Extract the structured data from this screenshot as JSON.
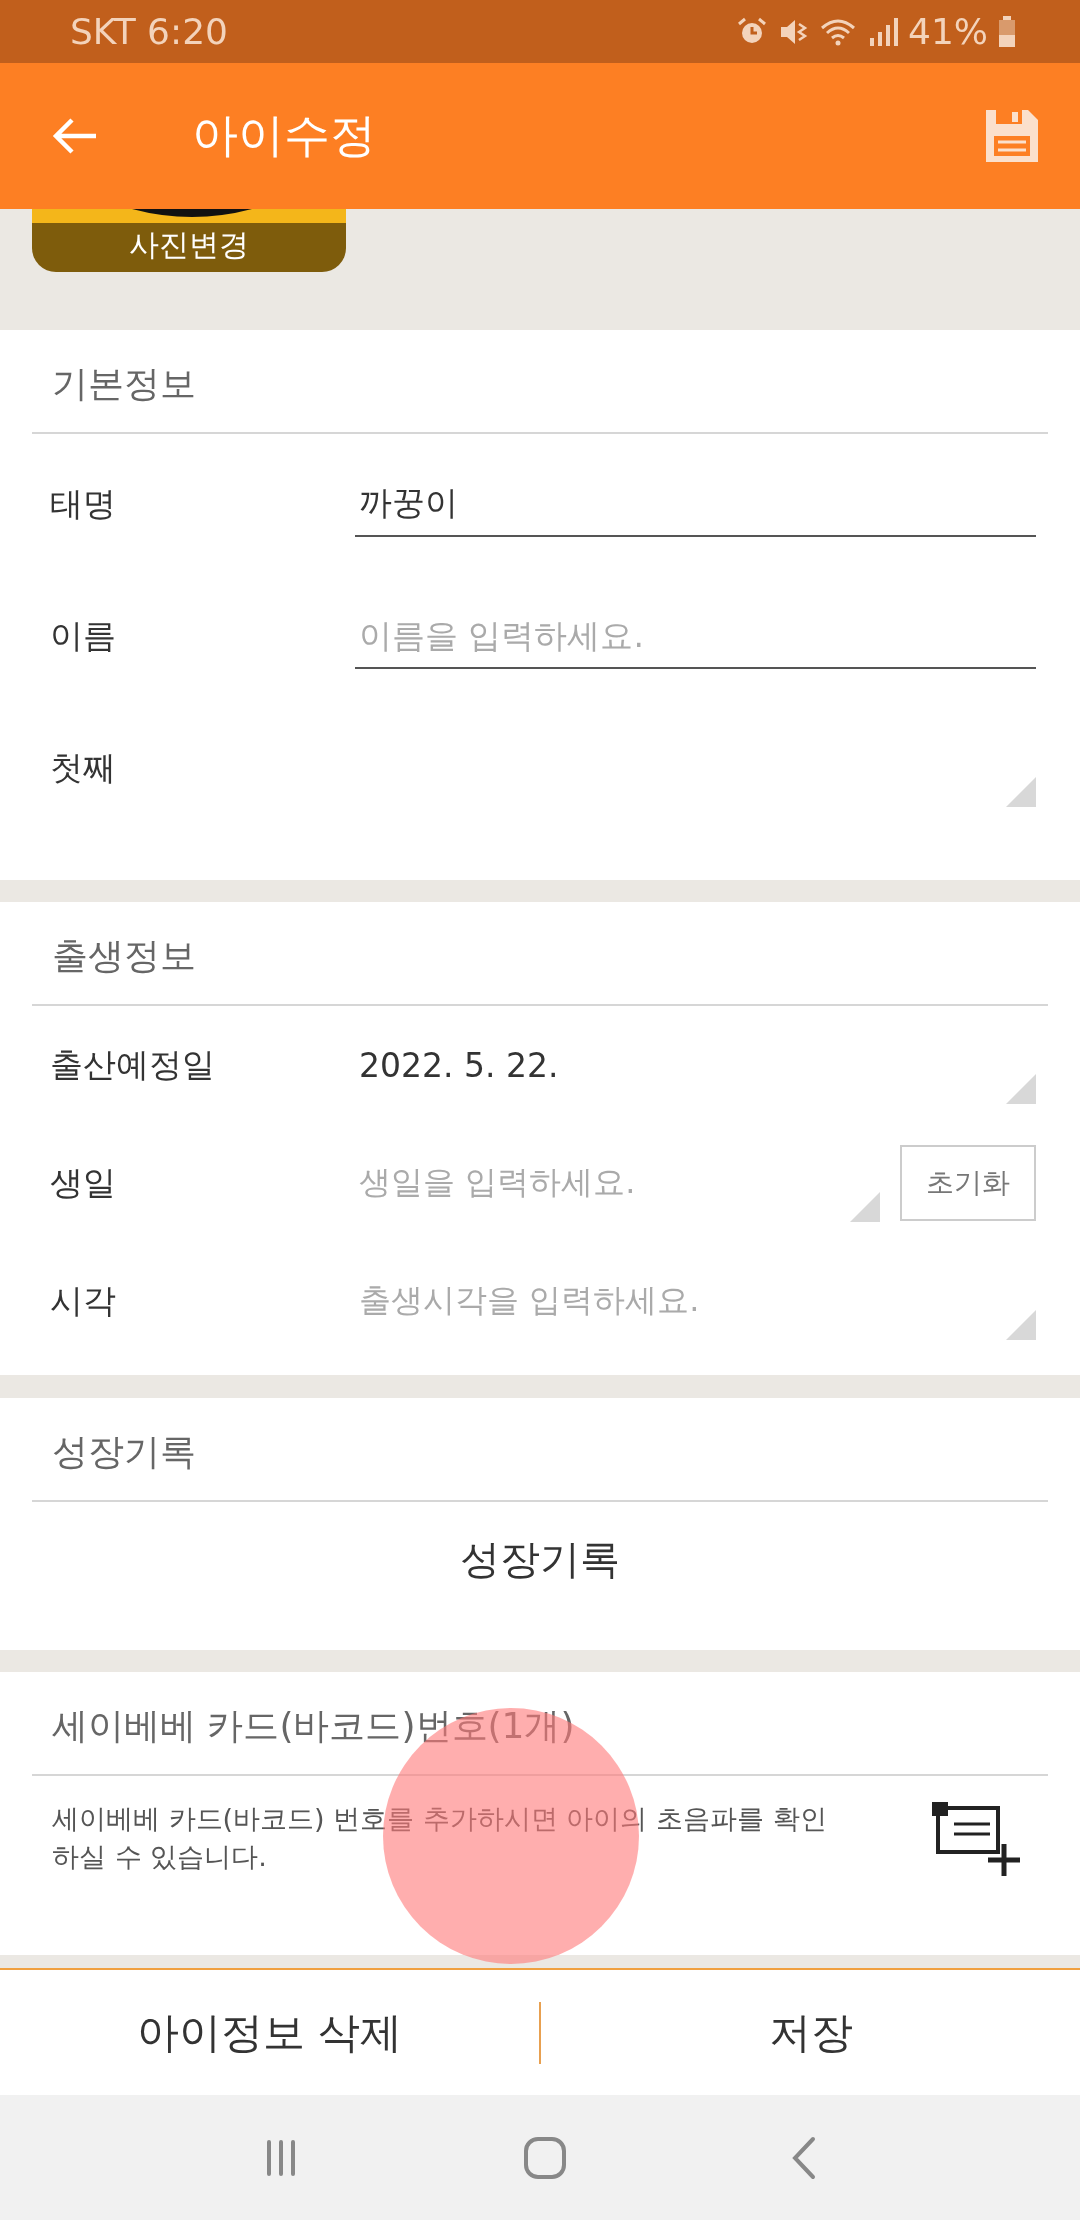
{
  "status_bar": {
    "carrier_time": "SKT 6:20",
    "battery": "41%"
  },
  "app_bar": {
    "title": "아이수정"
  },
  "photo": {
    "label": "사진변경"
  },
  "basic_info": {
    "title": "기본정보",
    "rows": [
      {
        "kind": "input",
        "label": "태명",
        "value": "까꿍이"
      },
      {
        "kind": "input",
        "label": "이름",
        "placeholder": "이름을 입력하세요."
      },
      {
        "kind": "select",
        "value": "첫째"
      }
    ]
  },
  "birth_info": {
    "title": "출생정보",
    "rows": [
      {
        "kind": "select",
        "label": "출산예정일",
        "value": "2022. 5. 22."
      },
      {
        "kind": "select",
        "label": "생일",
        "placeholder": "생일을 입력하세요.",
        "reset_button": "초기화"
      },
      {
        "kind": "select",
        "label": "시각",
        "placeholder": "출생시각을 입력하세요."
      }
    ]
  },
  "growth": {
    "title": "성장기록",
    "button": "성장기록"
  },
  "card": {
    "title": "세이베베 카드(바코드)번호(1개)",
    "description": "세이베베 카드(바코드) 번호를 추가하시면 아이의 초음파를 확인하실 수 있습니다."
  },
  "bottom_buttons": [
    "아이정보 삭제",
    "저장"
  ],
  "touch_indicator": true
}
